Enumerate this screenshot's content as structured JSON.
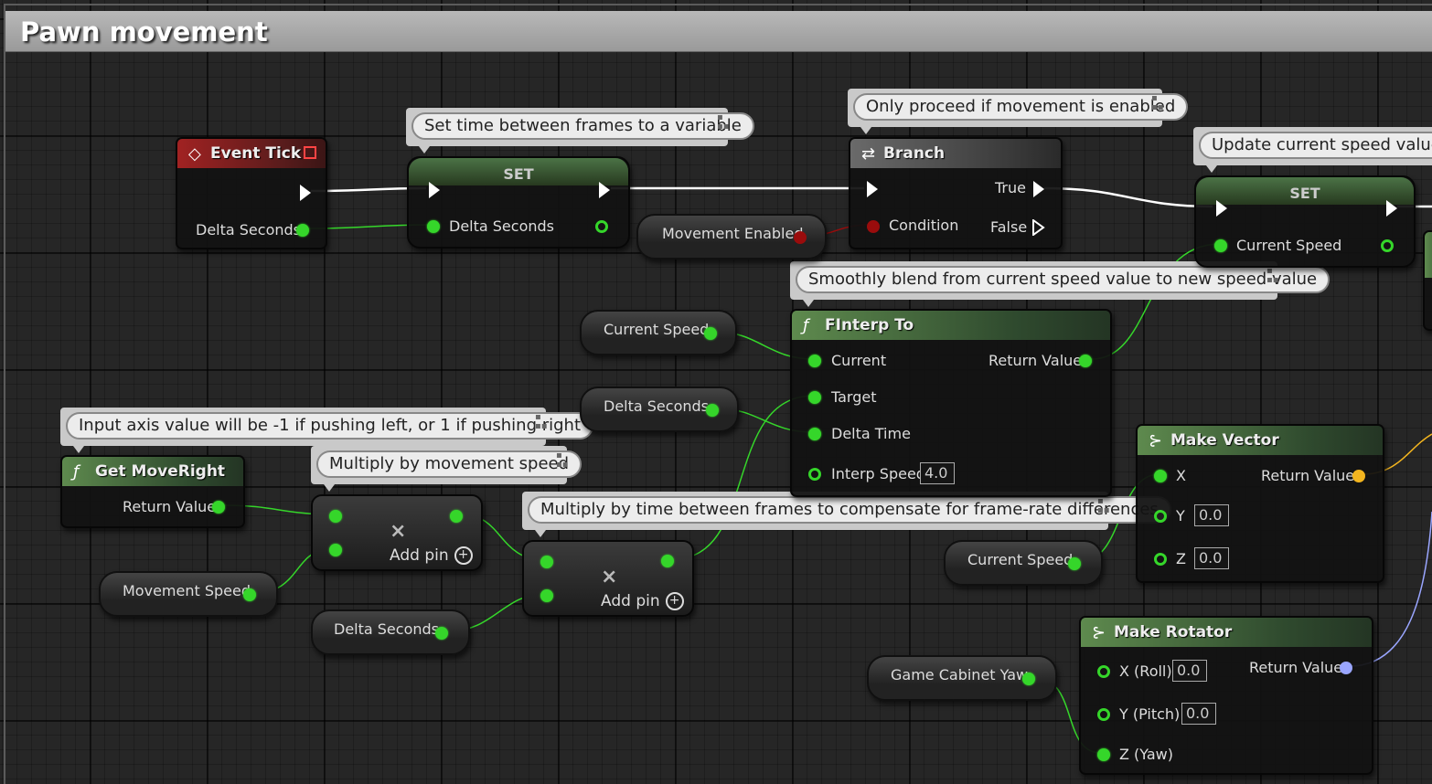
{
  "graph": {
    "title": "Pawn movement"
  },
  "comments": {
    "set_time": "Set time between frames to a variable",
    "proceed": "Only proceed if movement is enabled",
    "update_speed": "Update current speed value",
    "blend": "Smoothly blend from current speed value to new speed value",
    "input_axis": "Input axis value will be -1 if pushing left, or 1 if pushing right",
    "multiply_speed": "Multiply by movement speed",
    "multiply_time": "Multiply by time between frames to compensate for frame-rate differences"
  },
  "nodes": {
    "event_tick": {
      "title": "Event Tick",
      "out_label": "Delta Seconds"
    },
    "set_delta": {
      "title": "SET",
      "in_label": "Delta Seconds"
    },
    "movement_enabled": {
      "label": "Movement Enabled"
    },
    "branch": {
      "title": "Branch",
      "condition": "Condition",
      "true_label": "True",
      "false_label": "False"
    },
    "set_speed": {
      "title": "SET",
      "in_label": "Current Speed"
    },
    "current_speed_1": {
      "label": "Current Speed"
    },
    "delta_seconds_1": {
      "label": "Delta Seconds"
    },
    "finterp": {
      "title": "FInterp To",
      "current": "Current",
      "target": "Target",
      "delta_time": "Delta Time",
      "interp_speed": "Interp Speed",
      "interp_speed_value": "4.0",
      "return_label": "Return Value"
    },
    "get_moveright": {
      "title": "Get MoveRight",
      "return_label": "Return Value"
    },
    "multiply_1": {
      "add_pin": "Add pin"
    },
    "movement_speed": {
      "label": "Movement Speed"
    },
    "delta_seconds_2": {
      "label": "Delta Seconds"
    },
    "multiply_2": {
      "add_pin": "Add pin"
    },
    "current_speed_2": {
      "label": "Current Speed"
    },
    "make_vector": {
      "title": "Make Vector",
      "x": "X",
      "y": "Y",
      "z": "Z",
      "y_value": "0.0",
      "z_value": "0.0",
      "return_label": "Return Value"
    },
    "game_cabinet_yaw": {
      "label": "Game Cabinet Yaw"
    },
    "make_rotator": {
      "title": "Make Rotator",
      "roll": "X (Roll)",
      "pitch": "Y (Pitch)",
      "yaw": "Z (Yaw)",
      "roll_value": "0.0",
      "pitch_value": "0.0",
      "return_label": "Return Value"
    }
  },
  "colors": {
    "exec": "#ffffff",
    "float": "#35d62a",
    "bool": "#9a0c0c",
    "vector": "#f3b51f",
    "rotator": "#9aa6ff"
  }
}
